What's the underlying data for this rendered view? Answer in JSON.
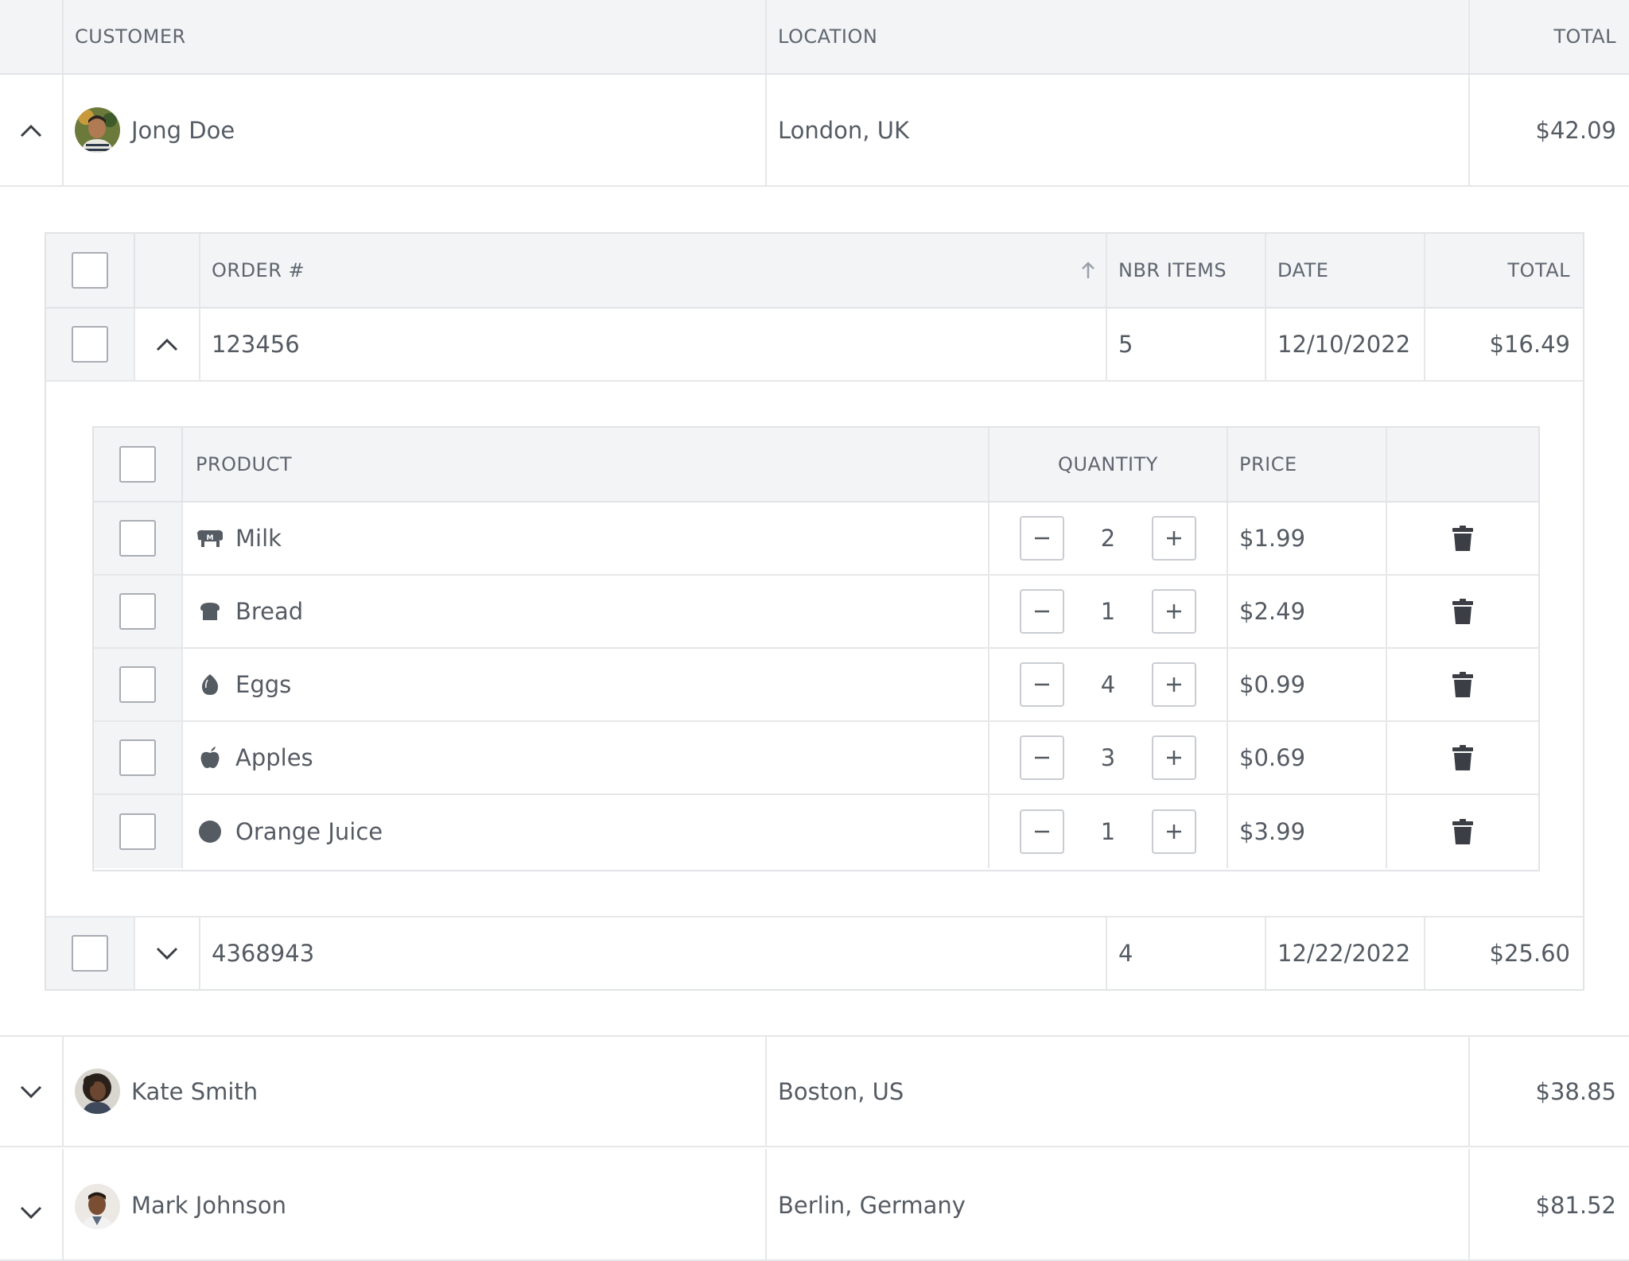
{
  "customers_grid": {
    "columns": {
      "customer": "CUSTOMER",
      "location": "LOCATION",
      "total": "TOTAL"
    },
    "rows": [
      {
        "name": "Jong Doe",
        "location": "London, UK",
        "total": "$42.09",
        "expanded": true
      },
      {
        "name": "Kate Smith",
        "location": "Boston, US",
        "total": "$38.85",
        "expanded": false
      },
      {
        "name": "Mark Johnson",
        "location": "Berlin, Germany",
        "total": "$81.52",
        "expanded": false
      }
    ]
  },
  "orders_grid": {
    "columns": {
      "order": "ORDER #",
      "items": "NBR ITEMS",
      "date": "DATE",
      "total": "TOTAL"
    },
    "rows": [
      {
        "order": "123456",
        "items": "5",
        "date": "12/10/2022",
        "total": "$16.49",
        "expanded": true
      },
      {
        "order": "4368943",
        "items": "4",
        "date": "12/22/2022",
        "total": "$25.60",
        "expanded": false
      }
    ]
  },
  "products_grid": {
    "columns": {
      "product": "PRODUCT",
      "quantity": "QUANTITY",
      "price": "PRICE"
    },
    "rows": [
      {
        "name": "Milk",
        "icon": "cow-icon",
        "quantity": "2",
        "price": "$1.99"
      },
      {
        "name": "Bread",
        "icon": "bread-icon",
        "quantity": "1",
        "price": "$2.49"
      },
      {
        "name": "Eggs",
        "icon": "egg-icon",
        "quantity": "4",
        "price": "$0.99"
      },
      {
        "name": "Apples",
        "icon": "apple-icon",
        "quantity": "3",
        "price": "$0.69"
      },
      {
        "name": "Orange Juice",
        "icon": "circle-icon",
        "quantity": "1",
        "price": "$3.99"
      }
    ]
  },
  "colors": {
    "header_bg": "#f3f4f6",
    "border": "#e6e7e9",
    "text": "#555b63",
    "icon": "#555b63"
  }
}
